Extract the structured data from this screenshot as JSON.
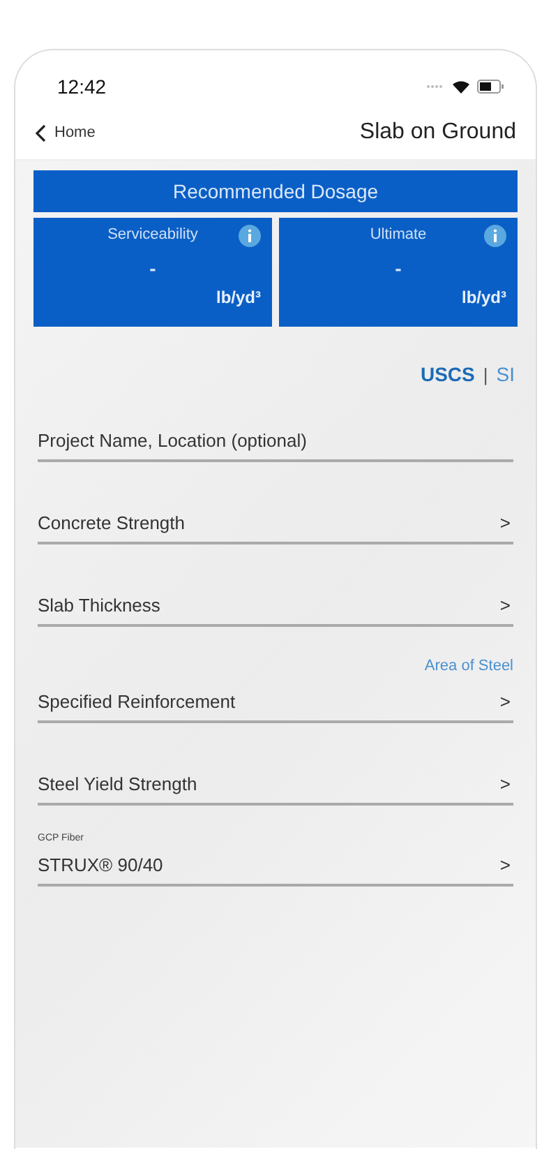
{
  "status_bar": {
    "time": "12:42"
  },
  "nav": {
    "back": "Home",
    "title": "Slab on Ground"
  },
  "dosage": {
    "title": "Recommended Dosage",
    "cards": [
      {
        "label": "Serviceability",
        "value": "-",
        "unit": "lb/yd³"
      },
      {
        "label": "Ultimate",
        "value": "-",
        "unit": "lb/yd³"
      }
    ]
  },
  "units": {
    "options": [
      {
        "label": "USCS",
        "selected": true
      },
      {
        "label": "SI",
        "selected": false
      }
    ],
    "separator": "|"
  },
  "fields": [
    {
      "kind": "text",
      "placeholder": "Project Name, Location (optional)"
    },
    {
      "kind": "picker",
      "label": "Concrete Strength",
      "chevron": ">"
    },
    {
      "kind": "picker",
      "label": "Slab Thickness",
      "chevron": ">"
    },
    {
      "kind": "picker",
      "label": "Specified Reinforcement",
      "link": "Area of Steel",
      "chevron": ">"
    },
    {
      "kind": "picker",
      "label": "Steel Yield Strength",
      "chevron": ">"
    },
    {
      "kind": "picker",
      "label": "STRUX® 90/40",
      "caption": "GCP Fiber",
      "chevron": ">"
    }
  ]
}
